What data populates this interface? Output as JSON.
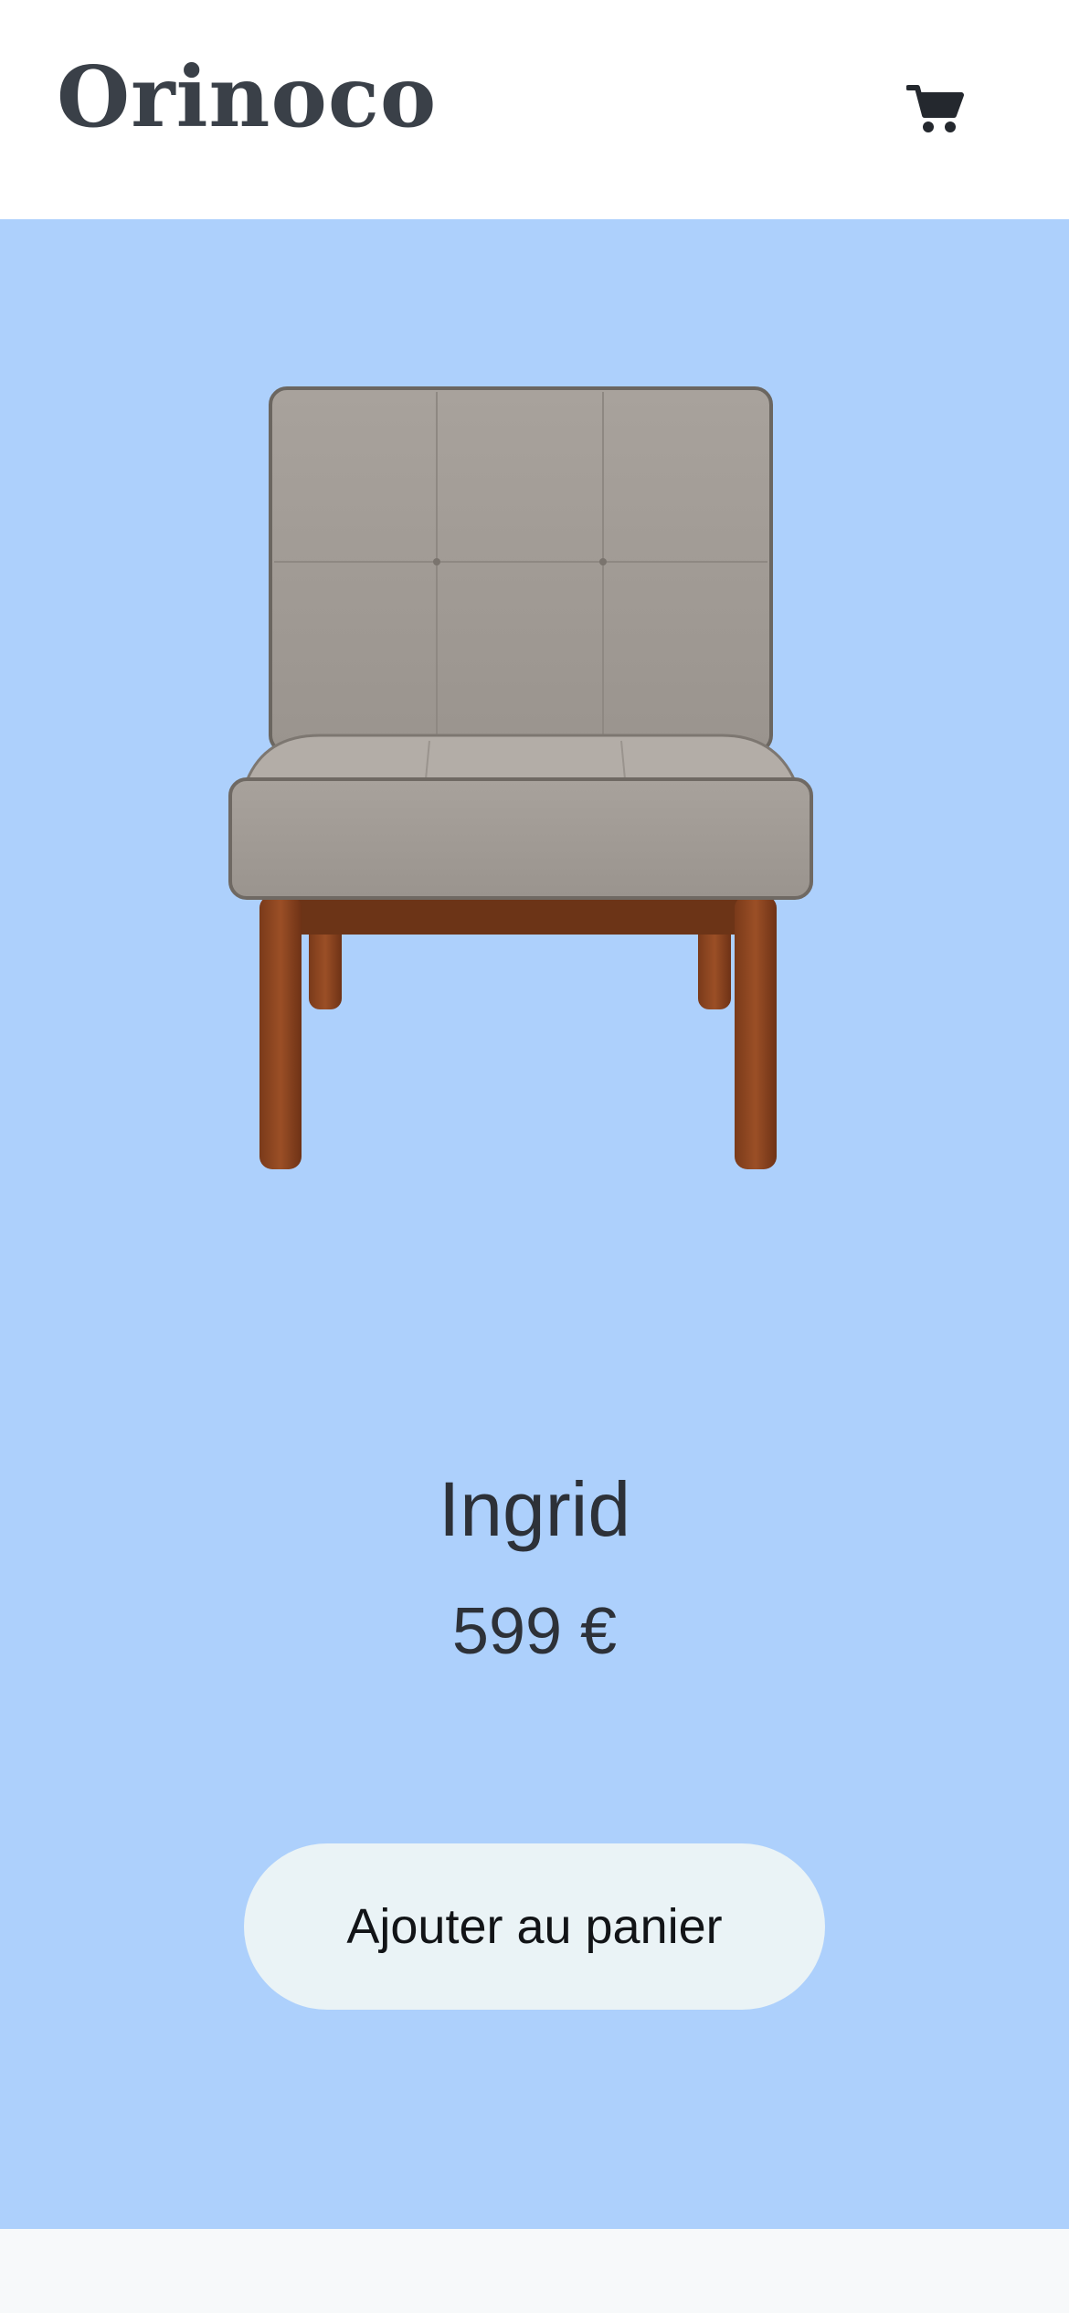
{
  "header": {
    "brand": "Orinoco",
    "cart_icon": "shopping-cart-icon"
  },
  "product": {
    "image_icon": "chair-product-image",
    "name": "Ingrid",
    "price": "599 €"
  },
  "actions": {
    "add_to_cart_label": "Ajouter au panier"
  },
  "colors": {
    "hero_background": "#add0fc",
    "button_background": "#eaf3f6",
    "text_dark": "#2d3138",
    "logo": "#3a4048"
  }
}
